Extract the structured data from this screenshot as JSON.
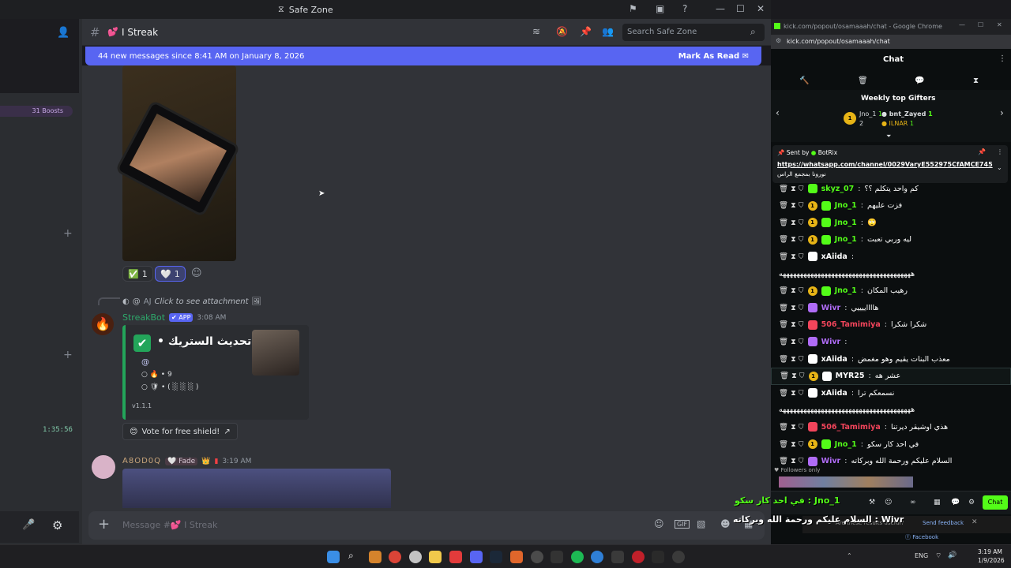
{
  "discord": {
    "window_title": "Safe Zone",
    "boosts": "31 Boosts",
    "timer": "1:35:56",
    "channel": {
      "emoji": "💕",
      "name": "I Streak"
    },
    "search_placeholder": "Search Safe Zone",
    "banner": {
      "text": "44 new messages since 8:41 AM on January 8, 2026",
      "action": "Mark As Read"
    },
    "reactions": [
      {
        "emoji": "✅",
        "count": "1"
      },
      {
        "emoji": "🤍",
        "count": "1"
      }
    ],
    "reply": {
      "mention": "@",
      "user": "AJ",
      "text": "Click to see attachment"
    },
    "streakbot": {
      "name": "StreakBot",
      "app_badge": "✔ APP",
      "time": "3:08 AM",
      "embed_title": "تم تحديث الستريك",
      "mention": "@",
      "line1": "🔥 • 9",
      "line2": "🛡 • (  ░  ░  ░  )",
      "version": "v1.1.1",
      "vote": "Vote for free shield!"
    },
    "msg3": {
      "name": "A8OD0Q",
      "fade": "Fade",
      "time": "3:19 AM"
    },
    "composer_placeholder": "Message #💕 I Streak"
  },
  "chrome": {
    "title": "kick.com/popout/osamaaah/chat - Google Chrome",
    "url": "kick.com/popout/osamaaah/chat"
  },
  "chat": {
    "header": "Chat",
    "weekly_title": "Weekly top Gifters",
    "gifters": [
      {
        "rank": "1",
        "name": "Jno_1",
        "count": "1"
      },
      {
        "rank": "",
        "name": "bnt_Zayed",
        "count": "1"
      },
      {
        "rank": "2",
        "name": "",
        "count": ""
      },
      {
        "rank": "",
        "name": "ILNAR",
        "count": "1"
      }
    ],
    "pinned": {
      "sent_by": "Sent by",
      "bot": "BotRix",
      "link": "https://whatsapp.com/channel/0029VaryE552975CfAMCE745",
      "text": "نورونا بمجمع الراس"
    },
    "messages": [
      {
        "user": "skyz_07",
        "color": "#53fc18",
        "text": "كم واحد يتكلم ؟؟",
        "gold": false
      },
      {
        "user": "Jno_1",
        "color": "#53fc18",
        "text": "فزت عليهم",
        "gold": true
      },
      {
        "user": "Jno_1",
        "color": "#53fc18",
        "text": "🙄",
        "gold": true
      },
      {
        "user": "Jno_1",
        "color": "#53fc18",
        "text": "ليه وربي تعبت",
        "gold": true
      },
      {
        "user": "xAiida",
        "color": "#ffffff",
        "text": "",
        "gold": false
      },
      {
        "user": "",
        "color": "#ffffff",
        "text": "ههههههههههههههههههههههههههههههههههههههه",
        "gold": false
      },
      {
        "user": "Jno_1",
        "color": "#53fc18",
        "text": "رهيب المكان",
        "gold": true
      },
      {
        "user": "Wivr",
        "color": "#b06cf7",
        "text": "هااااييييي",
        "gold": false
      },
      {
        "user": "506_Tamimiya",
        "color": "#f2455b",
        "text": "شكرا شكرا",
        "gold": false
      },
      {
        "user": "Wivr",
        "color": "#b06cf7",
        "text": "",
        "gold": false
      },
      {
        "user": "xAiida",
        "color": "#ffffff",
        "text": "معذب البنات يقيم وهو مغمض",
        "gold": false
      },
      {
        "user": "MYR25",
        "color": "#ffffff",
        "text": "عشر هه",
        "gold": true
      },
      {
        "user": "xAiida",
        "color": "#ffffff",
        "text": "نسمعكم ترا",
        "gold": false
      },
      {
        "user": "",
        "color": "#ffffff",
        "text": "ههههههههههههههههههههههههههههههههههههههه",
        "gold": false
      },
      {
        "user": "506_Tamimiya",
        "color": "#f2455b",
        "text": "هذي اوشيقر ديرتنا",
        "gold": false
      },
      {
        "user": "Jno_1",
        "color": "#53fc18",
        "text": "في احد كار سكو",
        "gold": true
      },
      {
        "user": "Wivr",
        "color": "#b06cf7",
        "text": "السلام عليكم ورحمة الله وبركاته",
        "gold": false
      }
    ],
    "followers_only": "Followers only",
    "overlay1": "في احد كار سكو : Jno_1",
    "overlay2": "السلام عليكم ورحمة الله وبركاته : Wivr",
    "send_button": "Chat",
    "feedback_q": "Are these results useful?",
    "feedback_link": "Send feedback",
    "facebook": "Facebook"
  },
  "taskbar": {
    "lang": "ENG",
    "time": "3:19 AM",
    "date": "1/9/2026"
  },
  "colors": {
    "blurple": "#5865f2",
    "kick_green": "#53fc18",
    "discord_bg": "#313338"
  }
}
